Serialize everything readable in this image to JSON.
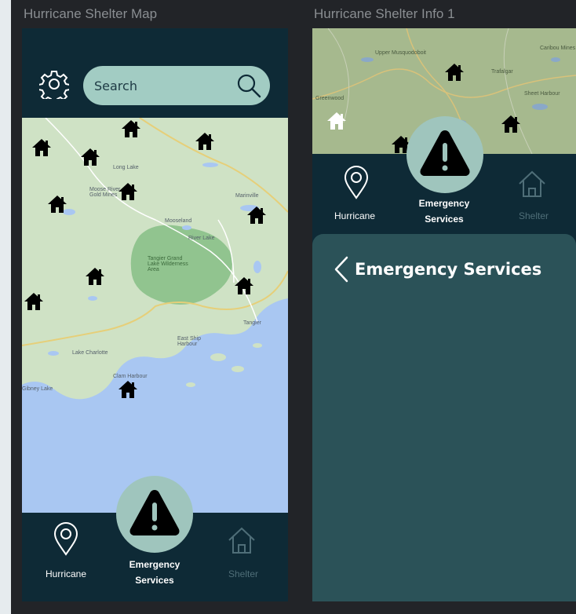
{
  "frames": [
    {
      "title": "Hurricane Shelter Map"
    },
    {
      "title": "Hurricane Shelter Info 1"
    }
  ],
  "search": {
    "placeholder": "Search"
  },
  "map": {
    "labels": [
      "Long Lake",
      "Moose River Gold Mines",
      "Mooseland",
      "Marinville",
      "River Lake",
      "Tangier Grand Lake Wilderness Area",
      "Tangier",
      "East Ship Harbour",
      "Lake Charlotte",
      "Clam Harbour",
      "Gibney Lake",
      "Upper Musquodoboit",
      "Greenwood",
      "Trafalgar",
      "Caribou Mines",
      "Sheet Harbour"
    ],
    "shelter_icon": "house-icon"
  },
  "nav": {
    "hurricane": "Hurricane",
    "emergency_line1": "Emergency",
    "emergency_line2": "Services",
    "shelter": "Shelter",
    "hurricane_icon": "location-pin-icon",
    "emergency_icon": "warning-triangle-icon",
    "shelter_icon": "home-outline-icon"
  },
  "panel": {
    "title": "Emergency Services",
    "back_icon": "chevron-left-icon"
  },
  "colors": {
    "frame_bg": "#0e2a36",
    "accent": "#a2ccc3",
    "panel_bg": "#2b5258",
    "water": "#a9c7f2",
    "land": "#cfe2c5",
    "park": "#91c48f",
    "inactive": "#4f6e78"
  }
}
